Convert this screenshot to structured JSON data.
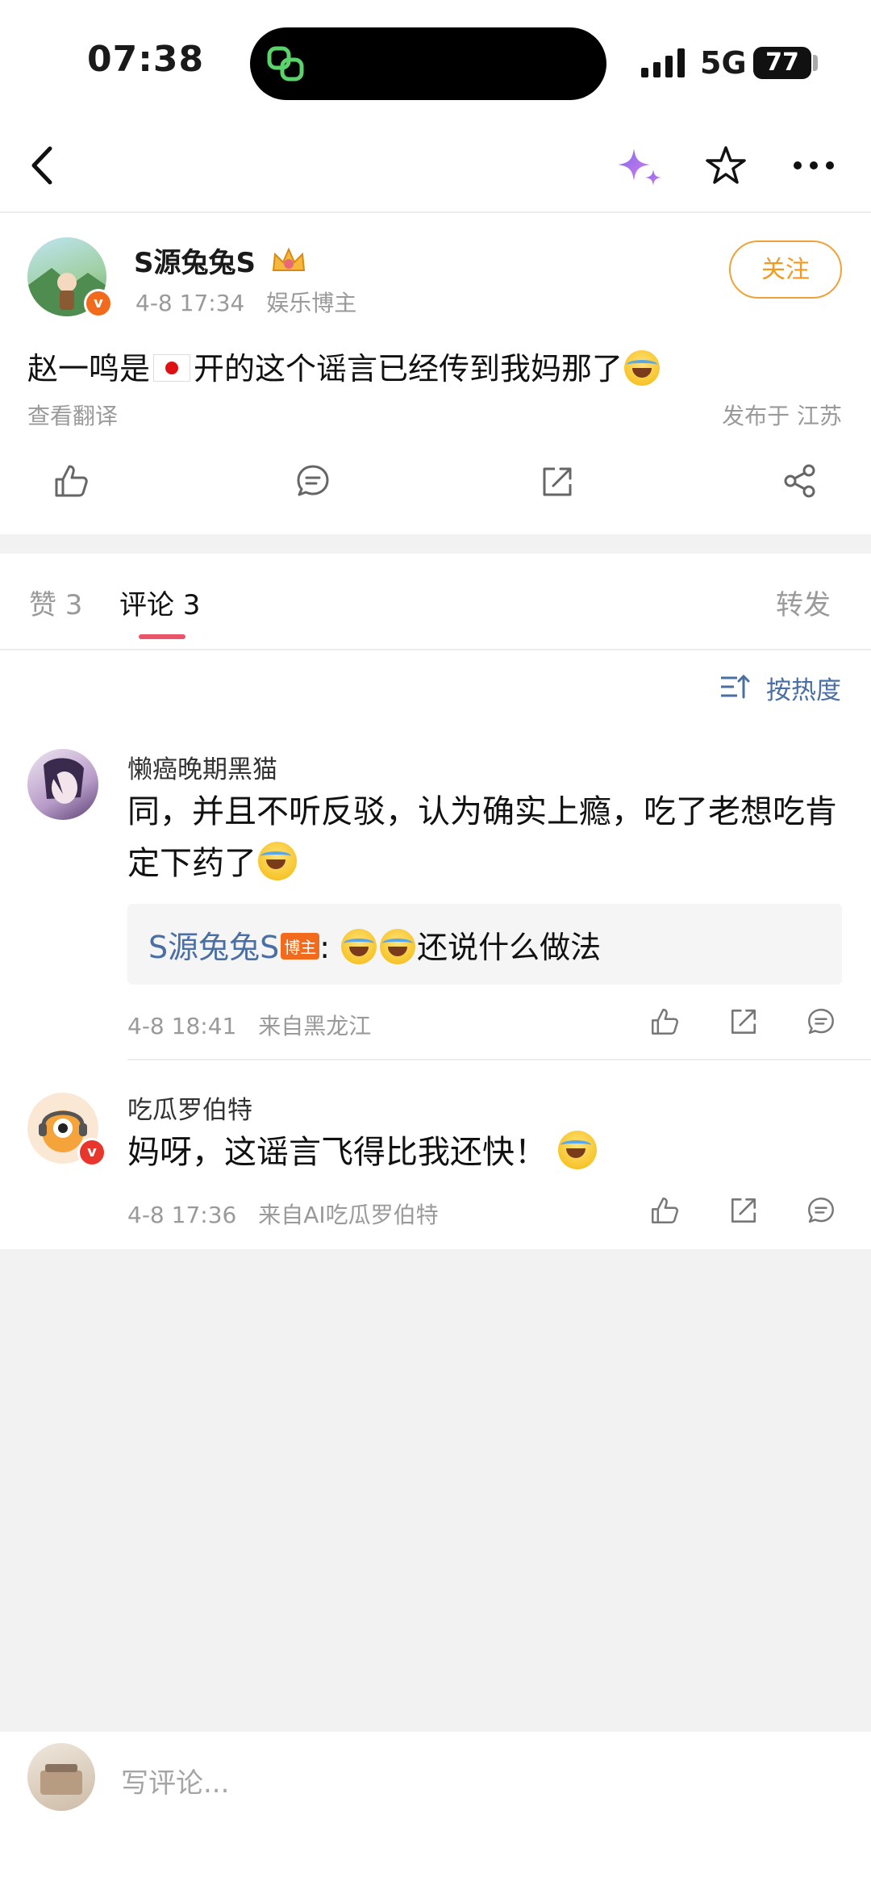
{
  "status": {
    "time": "07:38",
    "network": "5G",
    "battery": "77"
  },
  "nav": {
    "icons": [
      "back-icon",
      "sparkle-icon",
      "star-icon",
      "more-icon"
    ]
  },
  "post": {
    "username": "S源兔兔S",
    "timestamp": "4-8 17:34",
    "tag": "娱乐博主",
    "follow_label": "关注",
    "text_part1": "赵一鸣是",
    "text_part2": "开的这个谣言已经传到我妈那了",
    "translate_label": "查看翻译",
    "location": "发布于 江苏"
  },
  "tabs": {
    "likes": "赞 3",
    "comments": "评论 3",
    "reposts": "转发"
  },
  "sort": {
    "label": "按热度"
  },
  "comments": [
    {
      "name": "懒癌晚期黑猫",
      "text": "同，并且不听反驳，认为确实上瘾，吃了老想吃肯定下药了",
      "reply_author": "S源兔兔S",
      "reply_badge": "博主",
      "reply_text": "还说什么做法",
      "time": "4-8 18:41",
      "source": "来自黑龙江"
    },
    {
      "name": "吃瓜罗伯特",
      "text": "妈呀，这谣言飞得比我还快！",
      "time": "4-8 17:36",
      "source": "来自AI吃瓜罗伯特"
    }
  ],
  "composer": {
    "placeholder": "写评论..."
  },
  "colors": {
    "accent_red": "#e9546b",
    "follow_orange": "#f09a22",
    "link_blue": "#4a6fa5",
    "badge_orange": "#f26a1b"
  }
}
